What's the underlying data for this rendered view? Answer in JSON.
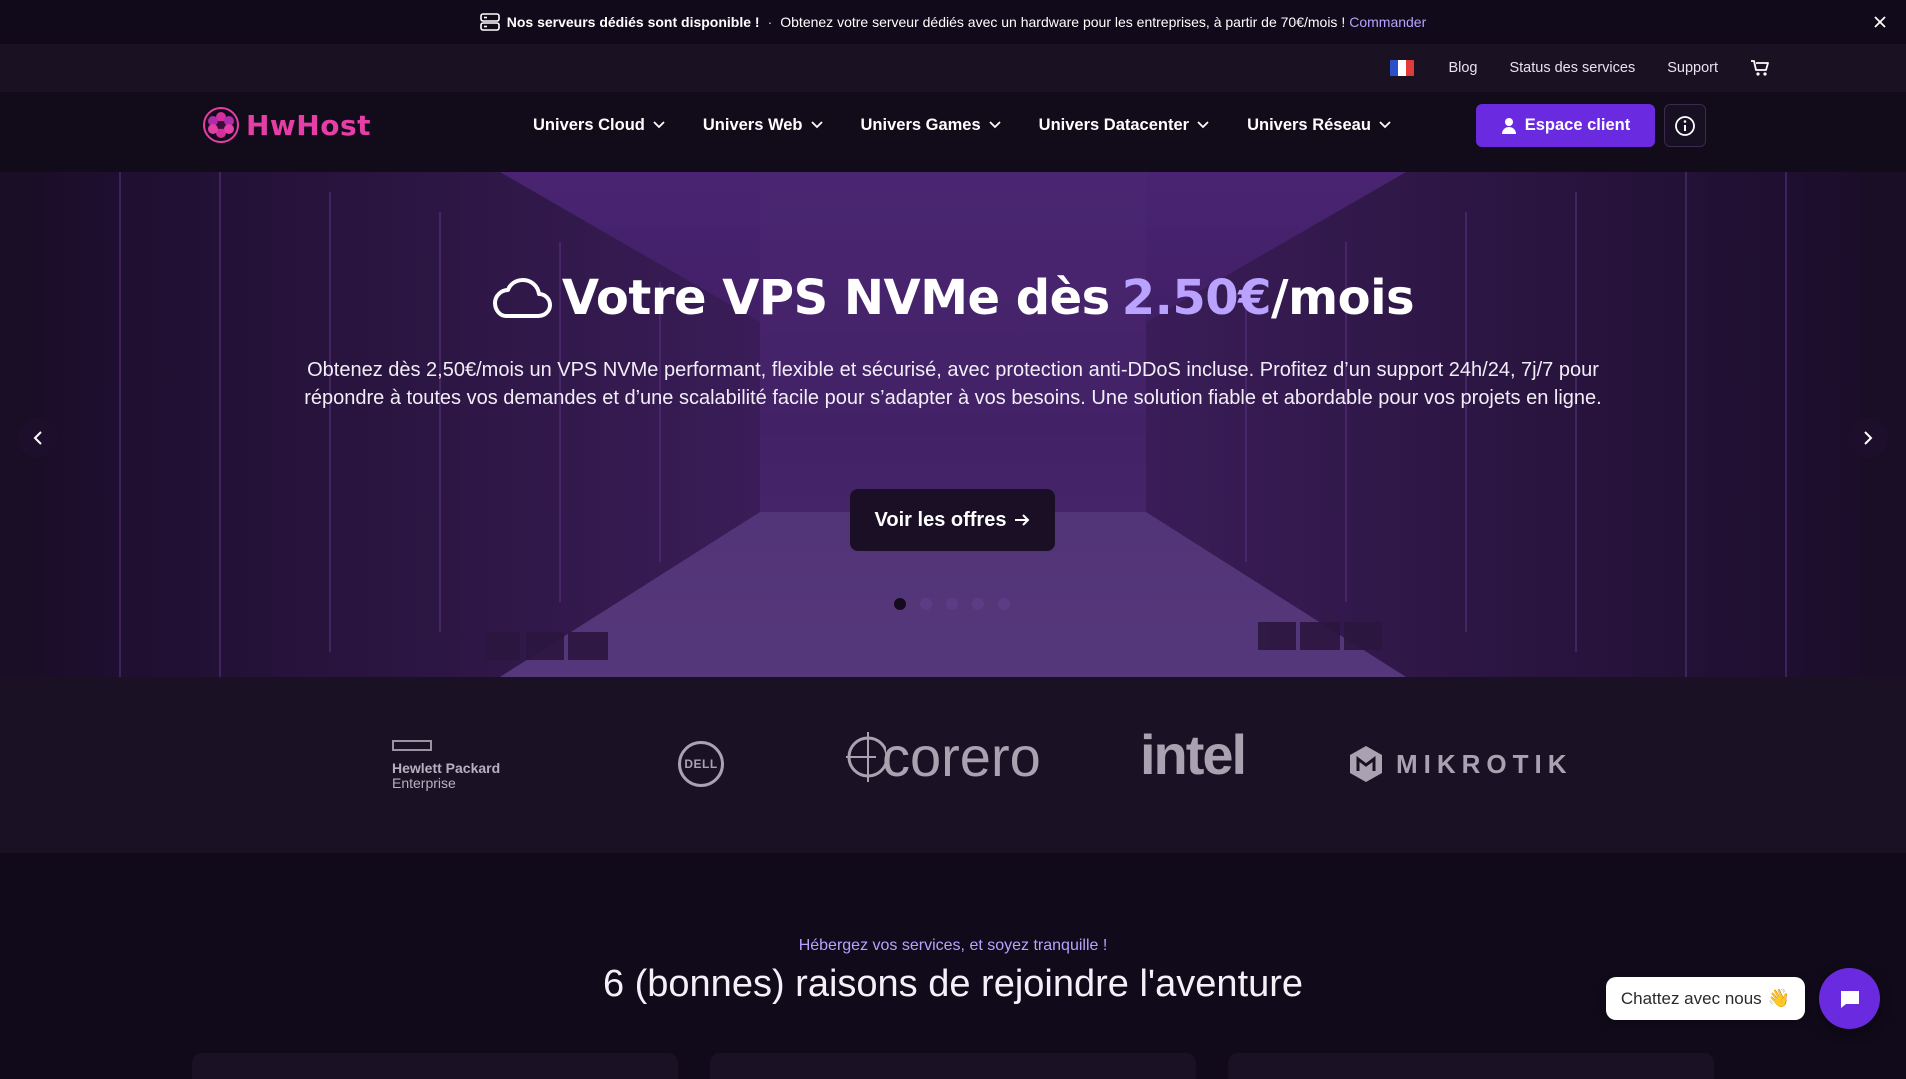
{
  "announcement": {
    "title": "Nos serveurs dédiés sont disponible !",
    "separator": "·",
    "text": "Obtenez votre serveur dédiés avec un hardware pour les entreprises, à partir de 70€/mois !",
    "link": "Commander",
    "icon": "server-icon"
  },
  "utility_bar": {
    "language_flag": "fr",
    "links": [
      "Blog",
      "Status des services",
      "Support"
    ]
  },
  "nav": {
    "logo_text": "HwHost",
    "menu": [
      "Univers Cloud",
      "Univers Web",
      "Univers Games",
      "Univers Datacenter",
      "Univers Réseau"
    ],
    "client_button": "Espace client"
  },
  "hero": {
    "title_prefix": "Votre VPS NVMe dès",
    "title_price": "2.50€",
    "title_suffix": "/mois",
    "description": "Obtenez dès 2,50€/mois un VPS NVMe performant, flexible et sécurisé, avec protection anti-DDoS incluse. Profitez d’un support 24h/24, 7j/7 pour répondre à toutes vos demandes et d’une scalabilité facile pour s’adapter à vos besoins. Une solution fiable et abordable pour vos projets en ligne.",
    "cta": "Voir les offres",
    "slide_count": 5,
    "active_slide": 1
  },
  "partners": {
    "hpe_line1": "Hewlett Packard",
    "hpe_line2": "Enterprise",
    "dell": "DELL",
    "corero": "corero",
    "intel": "intel",
    "mikrotik": "MIKROTIK"
  },
  "reasons": {
    "eyebrow": "Hébergez vos services, et soyez tranquille !",
    "title": "6 (bonnes) raisons de rejoindre l'aventure"
  },
  "chat": {
    "label": "Chattez avec nous",
    "emoji": "👋"
  },
  "colors": {
    "accent": "#6a2be0",
    "price_highlight": "#b9a3ff",
    "logo": "#e53ea6",
    "background": "#120a1c"
  }
}
